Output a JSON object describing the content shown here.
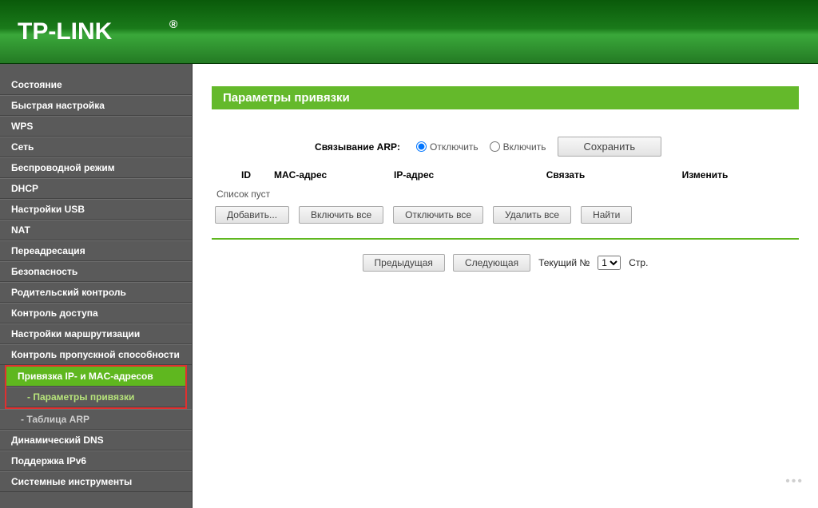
{
  "brand": "TP-LINK",
  "sidebar": {
    "items": [
      {
        "label": "Состояние"
      },
      {
        "label": "Быстрая настройка"
      },
      {
        "label": "WPS"
      },
      {
        "label": "Сеть"
      },
      {
        "label": "Беспроводной режим"
      },
      {
        "label": "DHCP"
      },
      {
        "label": "Настройки USB"
      },
      {
        "label": "NAT"
      },
      {
        "label": "Переадресация"
      },
      {
        "label": "Безопасность"
      },
      {
        "label": "Родительский контроль"
      },
      {
        "label": "Контроль доступа"
      },
      {
        "label": "Настройки маршрутизации"
      },
      {
        "label": "Контроль пропускной способности"
      },
      {
        "label": "Привязка IP- и MAC-адресов",
        "active": true,
        "children": [
          {
            "label": "- Параметры привязки",
            "current": true
          },
          {
            "label": "- Таблица ARP"
          }
        ]
      },
      {
        "label": "Динамический DNS"
      },
      {
        "label": "Поддержка IPv6"
      },
      {
        "label": "Системные инструменты"
      }
    ]
  },
  "panel": {
    "title": "Параметры привязки",
    "arp_label": "Связывание ARP:",
    "radio_disable": "Отключить",
    "radio_enable": "Включить",
    "save": "Сохранить",
    "cols": {
      "id": "ID",
      "mac": "MAC-адрес",
      "ip": "IP-адрес",
      "bind": "Связать",
      "modify": "Изменить"
    },
    "empty": "Список пуст",
    "buttons": {
      "add": "Добавить...",
      "enable_all": "Включить все",
      "disable_all": "Отключить все",
      "delete_all": "Удалить все",
      "find": "Найти"
    },
    "pager": {
      "prev": "Предыдущая",
      "next": "Следующая",
      "current_label": "Текущий №",
      "page_options": [
        "1"
      ],
      "page_suffix": "Стр."
    }
  }
}
